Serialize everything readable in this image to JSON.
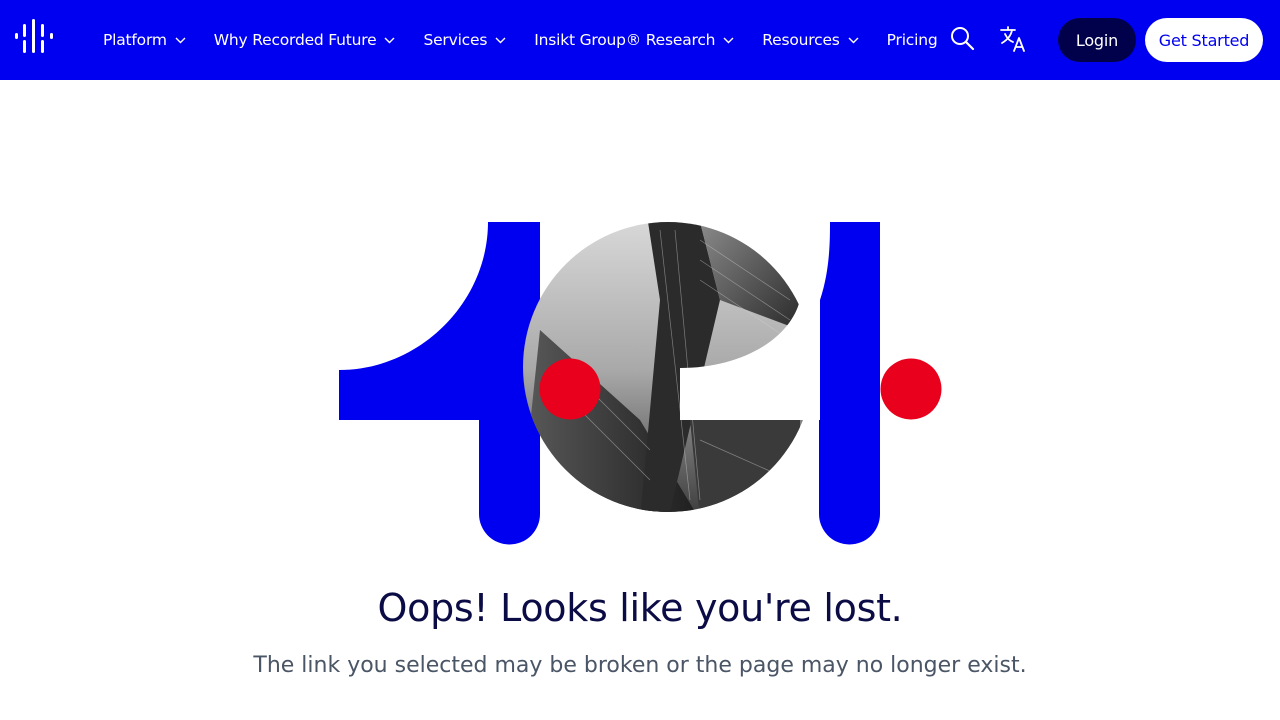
{
  "header": {
    "logo_name": "recorded-future-logo",
    "nav": [
      {
        "label": "Platform",
        "has_dropdown": true
      },
      {
        "label": "Why Recorded Future",
        "has_dropdown": true
      },
      {
        "label": "Services",
        "has_dropdown": true
      },
      {
        "label": "Insikt Group® Research",
        "has_dropdown": true
      },
      {
        "label": "Resources",
        "has_dropdown": true
      },
      {
        "label": "Pricing",
        "has_dropdown": false
      }
    ],
    "search_icon": "search-icon",
    "language_icon": "translate-icon",
    "login_label": "Login",
    "get_started_label": "Get Started"
  },
  "hero": {
    "graphic_text": "404",
    "headline": "Oops! Looks like you're lost.",
    "subline": "The link you selected may be broken or the page may no longer exist."
  },
  "colors": {
    "brand_blue": "#0000f0",
    "navy": "#00004b",
    "accent_red": "#e8001c",
    "text_dark": "#0b0b45",
    "text_muted": "#4a5566"
  }
}
